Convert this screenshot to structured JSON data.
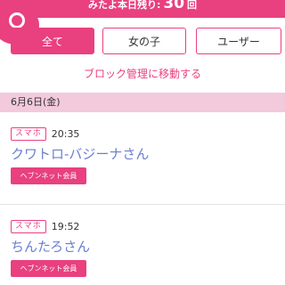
{
  "header": {
    "remaining_prefix": "みたよ本日残り:",
    "remaining_count": "30",
    "remaining_suffix": "回"
  },
  "tabs": [
    {
      "label": "全て",
      "active": true
    },
    {
      "label": "女の子",
      "active": false
    },
    {
      "label": "ユーザー",
      "active": false
    }
  ],
  "block_link": "ブロック管理に移動する",
  "date_header": "6月6日(金)",
  "entries": [
    {
      "device": "スマホ",
      "time": "20:35",
      "name": "クワトロ-バジーナさん",
      "badge": "ヘブンネット会員"
    },
    {
      "device": "スマホ",
      "time": "19:52",
      "name": "ちんたろさん",
      "badge": "ヘブンネット会員"
    }
  ],
  "colors": {
    "accent": "#e9407f",
    "date_bar": "#f3c9dc",
    "name_link": "#6a7fd0"
  }
}
